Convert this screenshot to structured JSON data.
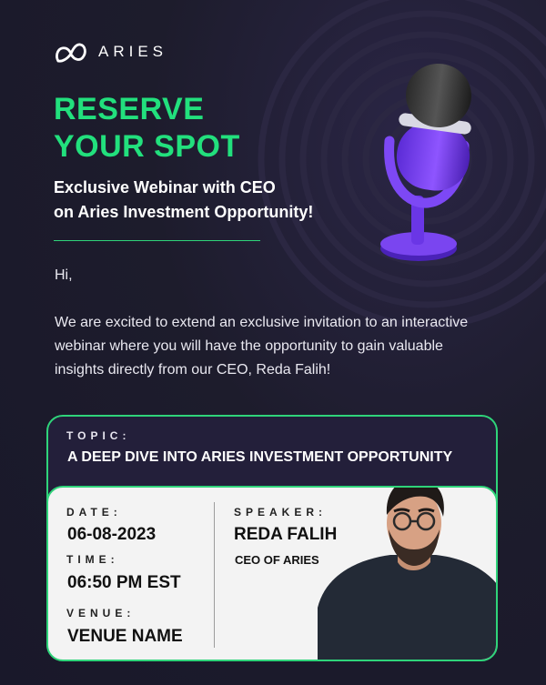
{
  "brand": {
    "name": "ARIES"
  },
  "hero": {
    "headline_line1": "RESERVE",
    "headline_line2": "YOUR SPOT",
    "subtitle_line1": "Exclusive Webinar with CEO",
    "subtitle_line2": "on Aries Investment Opportunity!"
  },
  "message": {
    "greeting": "Hi,",
    "body": "We are excited to extend an exclusive invitation to an interactive webinar where you will have the opportunity to gain valuable insights directly from our CEO, Reda Falih!"
  },
  "event": {
    "topic_label": "TOPIC:",
    "topic": "A DEEP DIVE INTO ARIES INVESTMENT OPPORTUNITY",
    "date_label": "DATE:",
    "date": "06-08-2023",
    "time_label": "TIME:",
    "time": "06:50 PM EST",
    "venue_label": "VENUE:",
    "venue": "VENUE NAME",
    "speaker_label": "SPEAKER:",
    "speaker_name": "REDA FALIH",
    "speaker_title": "CEO OF ARIES"
  },
  "colors": {
    "background": "#1d1c2b",
    "accent_green": "#22e07d",
    "accent_purple": "#7b3ff2",
    "card_light": "#f3f3f3"
  },
  "icons": [
    "aries-logo-icon",
    "microphone-icon"
  ]
}
